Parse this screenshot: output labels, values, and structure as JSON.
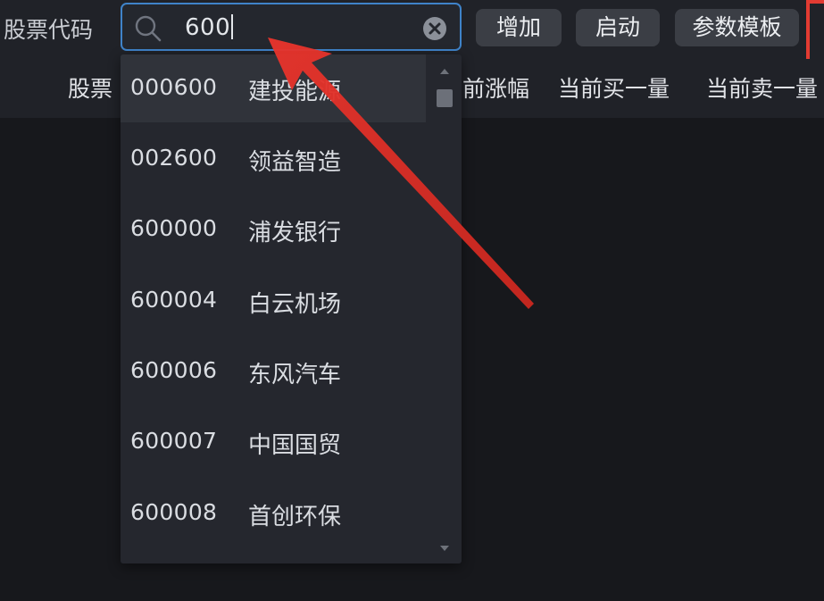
{
  "form": {
    "label": "股票代码",
    "search_value": "600"
  },
  "toolbar": {
    "add_label": "增加",
    "start_label": "启动",
    "template_label": "参数模板"
  },
  "table_header": {
    "code": "股票",
    "change": "前涨幅",
    "buy1": "当前买一量",
    "sell1": "当前卖一量"
  },
  "suggestions": [
    {
      "code": "000600",
      "name": "建投能源"
    },
    {
      "code": "002600",
      "name": "领益智造"
    },
    {
      "code": "600000",
      "name": "浦发银行"
    },
    {
      "code": "600004",
      "name": "白云机场"
    },
    {
      "code": "600006",
      "name": "东风汽车"
    },
    {
      "code": "600007",
      "name": "中国国贸"
    },
    {
      "code": "600008",
      "name": "首创环保"
    }
  ],
  "colors": {
    "background": "#17181c",
    "panel": "#202228",
    "focus_border": "#3f83c9",
    "annotation_red": "#e23b32"
  },
  "icons": [
    "search-icon",
    "clear-icon",
    "scroll-up-icon",
    "scroll-down-icon"
  ]
}
